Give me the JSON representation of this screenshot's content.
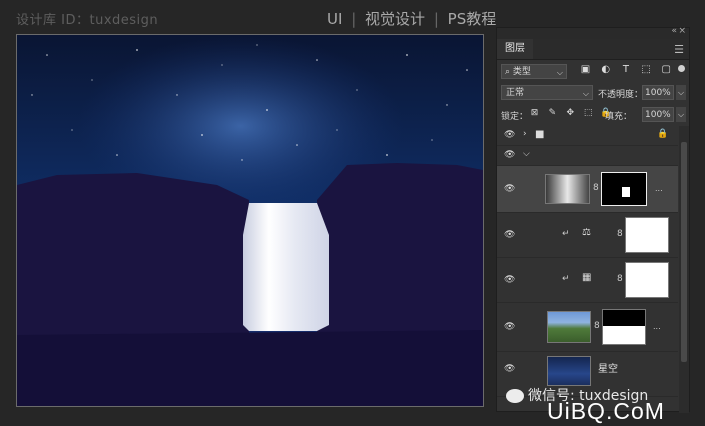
{
  "watermark": "设计库 ID：tuxdesign",
  "header_nav": {
    "item1": "UI",
    "sep1": "|",
    "item2": "视觉设计",
    "sep2": "|",
    "item3": "PS教程"
  },
  "icons": {
    "collapse": "«",
    "close": "×",
    "menu": "☰",
    "search": "⌕",
    "chevron": "⌵",
    "filter_image": "▣",
    "filter_adjust": "◐",
    "filter_type": "T",
    "filter_shape": "⬚",
    "filter_smart": "▢",
    "lock_pixels": "⊠",
    "lock_paint": "✎",
    "lock_move": "✥",
    "lock_artboard": "⬚",
    "lock_all": "🔒",
    "eye": "👁",
    "folder": "■",
    "link": "8",
    "clip": "↵",
    "balance": "⚖",
    "curves": "▦",
    "more": "..."
  },
  "layers_panel": {
    "tab_label": "图层",
    "filter_label": "类型",
    "blend_mode": "正常",
    "opacity_label": "不透明度：",
    "opacity_value": "100%",
    "lock_label": "锁定：",
    "fill_label": "填充：",
    "fill_value": "100%",
    "layers": [
      {
        "name": "",
        "type": "group-collapsed"
      },
      {
        "name": "",
        "type": "group-open"
      },
      {
        "name": "",
        "type": "smart-object-with-mask"
      },
      {
        "name": "",
        "type": "color-balance-adjustment"
      },
      {
        "name": "",
        "type": "curves-adjustment"
      },
      {
        "name": "",
        "type": "image-with-mask"
      },
      {
        "name": "星空",
        "type": "image"
      }
    ]
  },
  "footer_watermark": {
    "wechat": "微信号: tuxdesign",
    "site": "UiBQ.CoM"
  },
  "colors": {
    "app_bg": "#262626",
    "panel_bg": "#323232",
    "canvas_sky": "#0b1838",
    "accent_blue": "#3d6fd0"
  }
}
